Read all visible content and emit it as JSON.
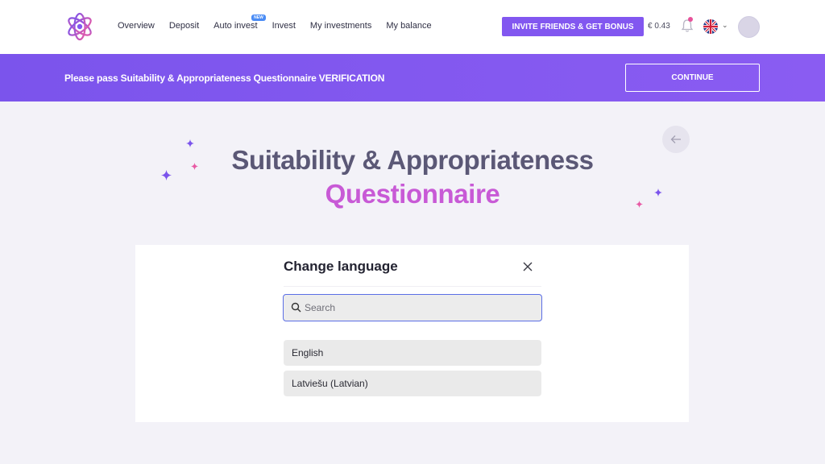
{
  "header": {
    "nav": [
      {
        "label": "Overview"
      },
      {
        "label": "Deposit"
      },
      {
        "label": "Auto invest",
        "badge": "NEW"
      },
      {
        "label": "Invest"
      },
      {
        "label": "My investments"
      },
      {
        "label": "My balance"
      }
    ],
    "invite_button": "INVITE FRIENDS & GET BONUS",
    "balance": "€ 0.43",
    "language_flag": "uk-flag-icon"
  },
  "banner": {
    "text": "Please pass Suitability & Appropriateness Questionnaire VERIFICATION",
    "button": "CONTINUE"
  },
  "page": {
    "title_line1": "Suitability & Appropriateness",
    "title_line2": "Questionnaire"
  },
  "modal": {
    "title": "Change language",
    "search_placeholder": "Search",
    "languages": [
      {
        "label": "English"
      },
      {
        "label": "Latviešu (Latvian)"
      }
    ]
  },
  "colors": {
    "accent": "#8257f0",
    "title_dark": "#5b5876",
    "title_pink": "#c85ad6",
    "background": "#f3f2f8"
  }
}
